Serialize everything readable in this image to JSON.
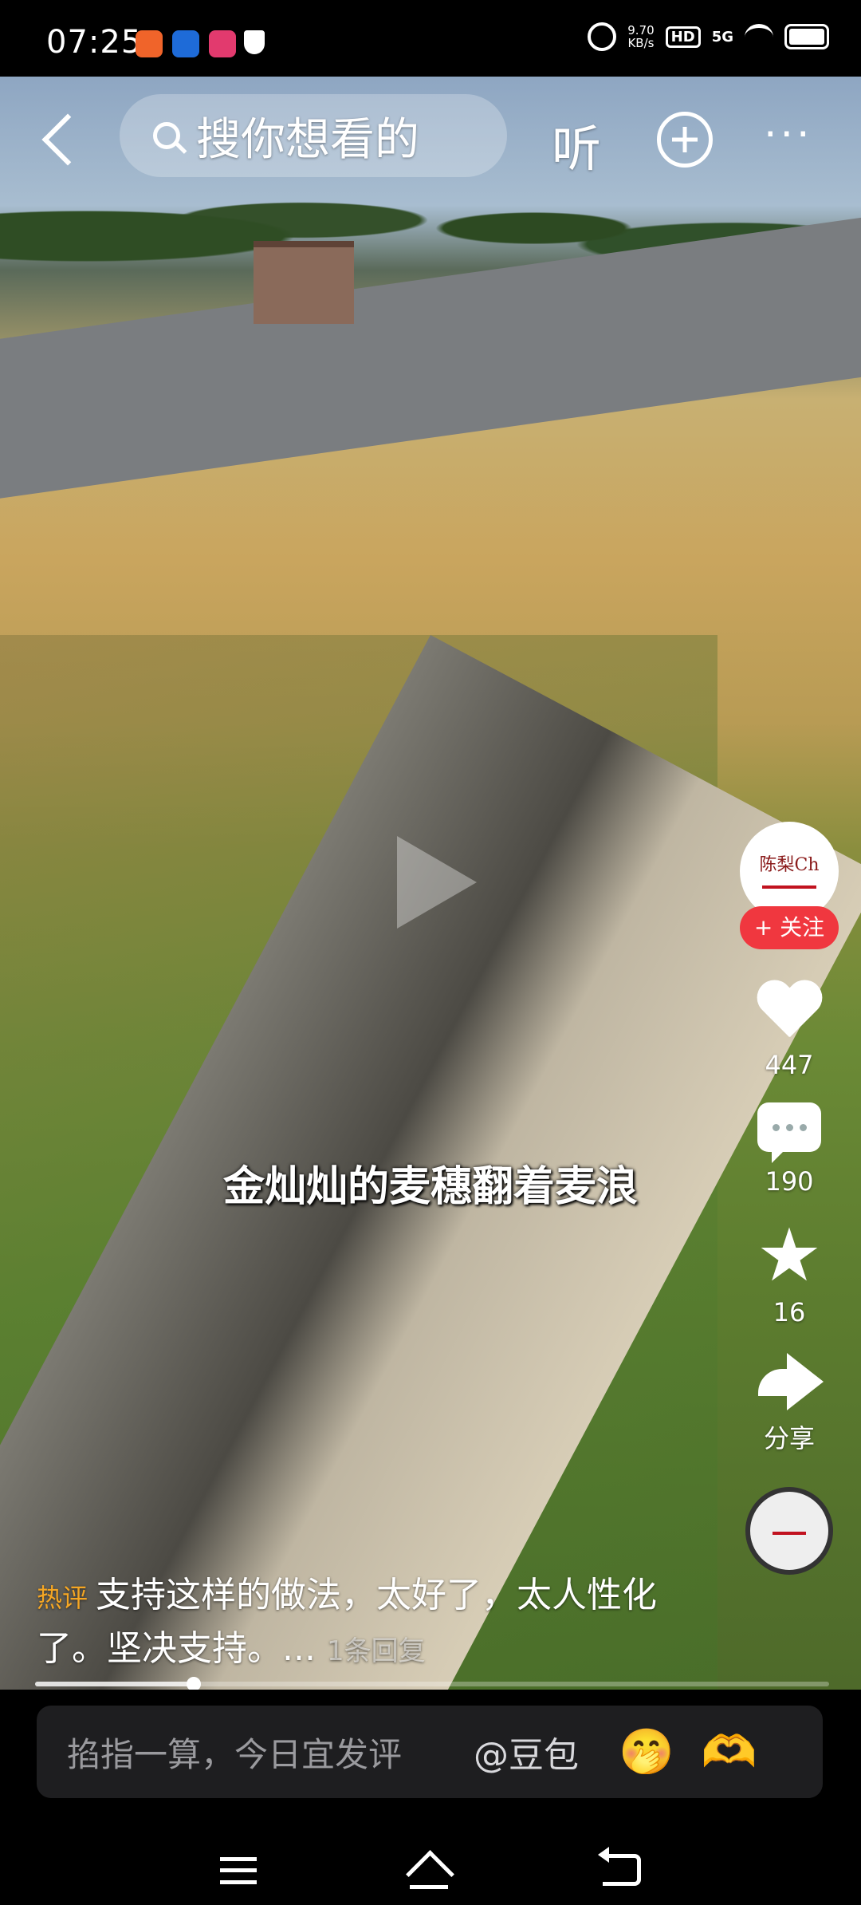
{
  "status_bar": {
    "time": "07:25",
    "net_speed": "9.70",
    "net_unit": "KB/s",
    "hd": "HD",
    "signal": "5G"
  },
  "top_bar": {
    "search_placeholder": "搜你想看的",
    "listen_label": "听"
  },
  "video": {
    "subtitle": "金灿灿的麦穗翻着麦浪"
  },
  "side_rail": {
    "avatar_text": "陈梨Ch",
    "follow_label": "+ 关注",
    "like_count": "447",
    "comment_count": "190",
    "favorite_count": "16",
    "share_label": "分享"
  },
  "hot_comment": {
    "tag": "热评",
    "text": "支持这样的做法，太好了，太人性化了。坚决支持。...",
    "reply": "1条回复"
  },
  "progress": {
    "fraction": 0.2
  },
  "comment_bar": {
    "placeholder": "掐指一算，今日宜发评",
    "mention": "@豆包",
    "emoji_1": "🤭",
    "emoji_2": "🫶"
  },
  "colors": {
    "follow_red": "#f0373f",
    "hot_tag": "#f5a623"
  }
}
